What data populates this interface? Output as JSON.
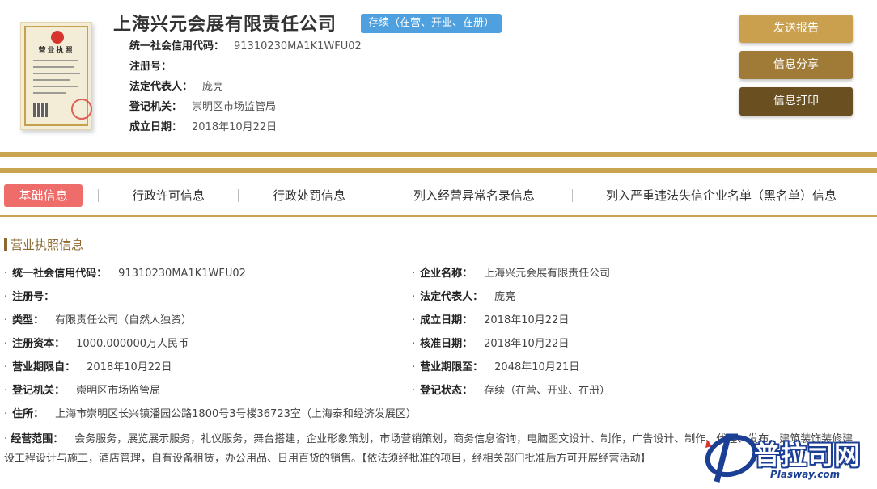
{
  "header": {
    "company_name": "上海兴元会展有限责任公司",
    "status": "存续（在营、开业、在册）",
    "fields": [
      {
        "key": "统一社会信用代码：",
        "value": "91310230MA1K1WFU02"
      },
      {
        "key": "注册号：",
        "value": ""
      },
      {
        "key": "法定代表人：",
        "value": "庞亮"
      },
      {
        "key": "登记机关：",
        "value": "崇明区市场监管局"
      },
      {
        "key": "成立日期：",
        "value": "2018年10月22日"
      }
    ],
    "license_thumb": {
      "title": "营业执照"
    }
  },
  "actions": {
    "send_report": "发送报告",
    "share_info": "信息分享",
    "print_info": "信息打印"
  },
  "tabs": [
    {
      "label": "基础信息",
      "active": true
    },
    {
      "label": "行政许可信息",
      "active": false
    },
    {
      "label": "行政处罚信息",
      "active": false
    },
    {
      "label": "列入经营异常名录信息",
      "active": false
    },
    {
      "label": "列入严重违法失信企业名单（黑名单）信息",
      "active": false
    }
  ],
  "section": {
    "title": "营业执照信息",
    "left": [
      {
        "key": "统一社会信用代码：",
        "value": "91310230MA1K1WFU02"
      },
      {
        "key": "注册号：",
        "value": ""
      },
      {
        "key": "类型：",
        "value": "有限责任公司（自然人独资）"
      },
      {
        "key": "注册资本：",
        "value": "1000.000000万人民币"
      },
      {
        "key": "营业期限自：",
        "value": "2018年10月22日"
      },
      {
        "key": "登记机关：",
        "value": "崇明区市场监管局"
      },
      {
        "key": "住所：",
        "value": "上海市崇明区长兴镇潘园公路1800号3号楼36723室（上海泰和经济发展区）"
      }
    ],
    "right": [
      {
        "key": "企业名称：",
        "value": "上海兴元会展有限责任公司"
      },
      {
        "key": "法定代表人：",
        "value": "庞亮"
      },
      {
        "key": "成立日期：",
        "value": "2018年10月22日"
      },
      {
        "key": "核准日期：",
        "value": "2018年10月22日"
      },
      {
        "key": "营业期限至：",
        "value": "2048年10月21日"
      },
      {
        "key": "登记状态：",
        "value": "存续（在营、开业、在册）"
      }
    ],
    "scope": {
      "key": "经营范围：",
      "value": "会务服务，展览展示服务，礼仪服务，舞台搭建，企业形象策划，市场营销策划，商务信息咨询，电脑图文设计、制作，广告设计、制作、代理、发布，建筑装饰装修建设工程设计与施工，酒店管理，自有设备租赁，办公用品、日用百货的销售。【依法须经批准的项目，经相关部门批准后方可开展经营活动】"
    }
  },
  "watermark": {
    "text": "普拉司网",
    "sub": "Plasway.com"
  },
  "colors": {
    "gold": "#c9a451",
    "badge_blue": "#4ea0df",
    "tab_active": "#ee6d6a",
    "btn_send": "#caa04f",
    "btn_share": "#a07a37",
    "btn_print": "#6a4f20"
  }
}
